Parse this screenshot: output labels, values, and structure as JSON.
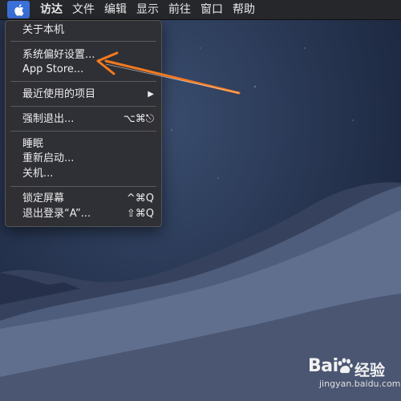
{
  "menubar": {
    "apple_icon": "apple-icon",
    "items": [
      "访达",
      "文件",
      "编辑",
      "显示",
      "前往",
      "窗口",
      "帮助"
    ]
  },
  "apple_menu": {
    "about": "关于本机",
    "system_prefs": "系统偏好设置...",
    "app_store": "App Store...",
    "recent_items": "最近使用的项目",
    "recent_arrow": "▶",
    "force_quit": "强制退出...",
    "force_quit_shortcut": "⌥⌘⎋",
    "sleep": "睡眠",
    "restart": "重新启动...",
    "shutdown": "关机...",
    "lock_screen": "锁定屏幕",
    "lock_shortcut": "^⌘Q",
    "logout": "退出登录“A”...",
    "logout_shortcut": "⇧⌘Q"
  },
  "annotation": {
    "arrow_color": "#f47a20"
  },
  "watermark": {
    "brand": "Bai",
    "brand_suffix": "经验",
    "url": "jingyan.baidu.com"
  },
  "colors": {
    "menubar": "#26272b",
    "apple_highlight": "#3a70d9",
    "menu_bg": "#303034",
    "desktop": "#2a3956"
  }
}
